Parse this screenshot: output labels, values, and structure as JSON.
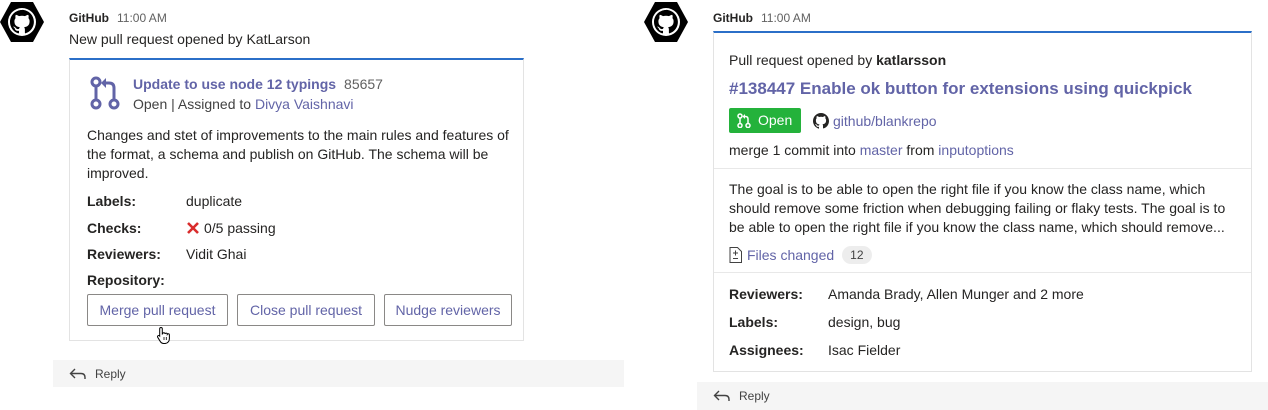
{
  "left_message": {
    "sender": "GitHub",
    "time": "11:00 AM",
    "text": "New pull request opened by KatLarson",
    "card": {
      "title": "Update to use node 12 typings",
      "number": "85657",
      "status_prefix": "Open | Assigned to",
      "assignee": "Divya Vaishnavi",
      "description": "Changes and stet of improvements to the main rules and features of the format, a schema and publish on GitHub. The schema will be improved.",
      "fields": {
        "labels_label": "Labels:",
        "labels_value": "duplicate",
        "checks_label": "Checks:",
        "checks_value": "0/5 passing",
        "reviewers_label": "Reviewers:",
        "reviewers_value": "Vidit Ghai",
        "repository_label": "Repository:"
      },
      "buttons": {
        "merge": "Merge pull request",
        "close": "Close pull request",
        "nudge": "Nudge reviewers"
      }
    },
    "reply_label": "Reply"
  },
  "right_message": {
    "sender": "GitHub",
    "time": "11:00 AM",
    "card": {
      "opened_prefix": "Pull request opened by",
      "opened_user": "katlarsson",
      "title": "#138447 Enable ok button for extensions using quickpick",
      "badge": "Open",
      "repo": "github/blankrepo",
      "merge_prefix": "merge 1 commit into",
      "merge_target": "master",
      "merge_mid": "from",
      "merge_source": "inputoptions",
      "description": "The goal is to be able to open the right file if you know the class name, which should remove some friction when debugging failing or flaky tests. The goal is to be able to open the right file if you know the class name, which should remove...",
      "files_changed_label": "Files changed",
      "files_changed_count": "12",
      "fields": {
        "reviewers_label": "Reviewers:",
        "reviewers_value": "Amanda Brady, Allen Munger and 2 more",
        "labels_label": "Labels:",
        "labels_value": "design, bug",
        "assignees_label": "Assignees:",
        "assignees_value": "Isac Fielder"
      }
    },
    "reply_label": "Reply"
  },
  "colors": {
    "accent": "#6264a7",
    "card_top_border": "#2b6fc8",
    "open_badge": "#24b23b",
    "error_x": "#d92c2c"
  },
  "icons": [
    "github-avatar-icon",
    "pull-request-icon",
    "x-mark-icon",
    "cursor-hand-icon",
    "github-mark-icon",
    "file-diff-icon",
    "reply-arrow-icon"
  ]
}
